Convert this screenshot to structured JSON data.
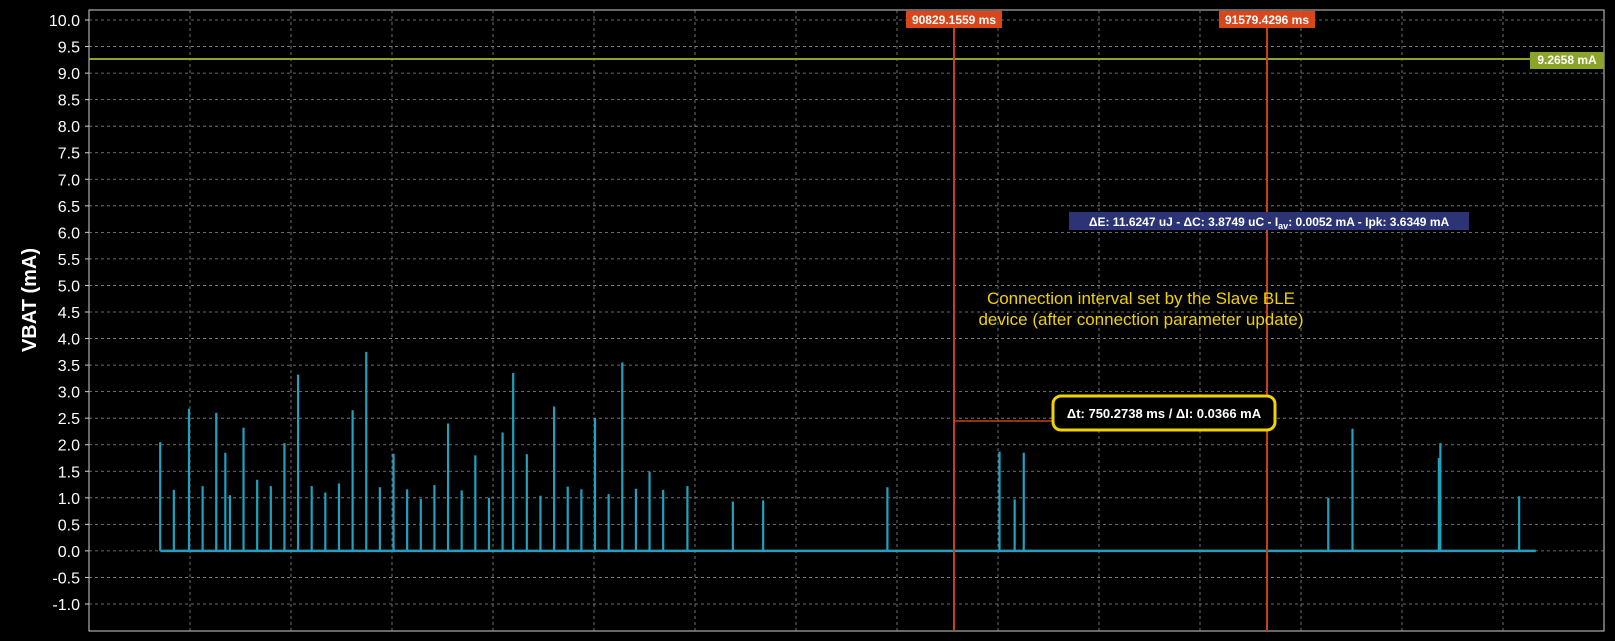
{
  "chart_data": {
    "type": "line",
    "ylabel": "VBAT (mA)",
    "xlabel": "",
    "ylim": [
      -1.0,
      10.0
    ],
    "yticks": [
      "10.0",
      "9.5",
      "9.0",
      "8.5",
      "8.0",
      "7.5",
      "7.0",
      "6.5",
      "6.0",
      "5.5",
      "5.0",
      "4.5",
      "4.0",
      "3.5",
      "3.0",
      "2.5",
      "2.0",
      "1.5",
      "1.0",
      "0.5",
      "0.0",
      "-0.5",
      "-1.0"
    ],
    "grid": true,
    "series": [
      {
        "name": "",
        "color": "#1fa2c0",
        "baseline": 0.0,
        "spikes": [
          {
            "x": 0.047,
            "y": 2.05
          },
          {
            "x": 0.056,
            "y": 1.15
          },
          {
            "x": 0.066,
            "y": 2.68
          },
          {
            "x": 0.075,
            "y": 1.22
          },
          {
            "x": 0.084,
            "y": 2.6
          },
          {
            "x": 0.09,
            "y": 1.85
          },
          {
            "x": 0.093,
            "y": 1.05
          },
          {
            "x": 0.102,
            "y": 2.32
          },
          {
            "x": 0.111,
            "y": 1.34
          },
          {
            "x": 0.12,
            "y": 1.22
          },
          {
            "x": 0.129,
            "y": 2.03
          },
          {
            "x": 0.138,
            "y": 3.32
          },
          {
            "x": 0.147,
            "y": 1.22
          },
          {
            "x": 0.156,
            "y": 1.1
          },
          {
            "x": 0.165,
            "y": 1.27
          },
          {
            "x": 0.174,
            "y": 2.65
          },
          {
            "x": 0.183,
            "y": 3.75
          },
          {
            "x": 0.192,
            "y": 1.2
          },
          {
            "x": 0.201,
            "y": 1.83
          },
          {
            "x": 0.21,
            "y": 1.16
          },
          {
            "x": 0.219,
            "y": 0.98
          },
          {
            "x": 0.228,
            "y": 1.24
          },
          {
            "x": 0.237,
            "y": 2.4
          },
          {
            "x": 0.246,
            "y": 1.14
          },
          {
            "x": 0.255,
            "y": 1.8
          },
          {
            "x": 0.264,
            "y": 1.0
          },
          {
            "x": 0.273,
            "y": 2.23
          },
          {
            "x": 0.28,
            "y": 3.35
          },
          {
            "x": 0.289,
            "y": 1.82
          },
          {
            "x": 0.298,
            "y": 1.04
          },
          {
            "x": 0.307,
            "y": 2.72
          },
          {
            "x": 0.316,
            "y": 1.21
          },
          {
            "x": 0.325,
            "y": 1.16
          },
          {
            "x": 0.334,
            "y": 2.5
          },
          {
            "x": 0.343,
            "y": 1.07
          },
          {
            "x": 0.352,
            "y": 3.55
          },
          {
            "x": 0.361,
            "y": 1.17
          },
          {
            "x": 0.37,
            "y": 1.49
          },
          {
            "x": 0.379,
            "y": 1.15
          },
          {
            "x": 0.395,
            "y": 1.22
          },
          {
            "x": 0.425,
            "y": 0.93
          },
          {
            "x": 0.445,
            "y": 0.95
          },
          {
            "x": 0.527,
            "y": 1.2
          },
          {
            "x": 0.601,
            "y": 1.87
          },
          {
            "x": 0.611,
            "y": 0.97
          },
          {
            "x": 0.617,
            "y": 1.85
          },
          {
            "x": 0.818,
            "y": 1.0
          },
          {
            "x": 0.834,
            "y": 2.3
          },
          {
            "x": 0.891,
            "y": 1.75
          },
          {
            "x": 0.892,
            "y": 2.03
          },
          {
            "x": 0.944,
            "y": 1.03
          }
        ]
      }
    ],
    "markers": {
      "cursor_1_label": "90829.1559 ms",
      "cursor_2_label": "91579.4296 ms",
      "cursor_color": "#c8401a",
      "level_label": "9.2658 mA",
      "level_value": 9.2658,
      "level_color": "#8aa52a"
    },
    "annotations": {
      "stats_parts": [
        "ΔE: 11.6247 uJ - ΔC: 3.8749 uC - I",
        "av",
        ": 0.0052 mA - Ipk: 3.6349 mA"
      ],
      "note_line1": "Connection interval set by the Slave BLE",
      "note_line2": "device (after connection parameter update)",
      "delta": "Δt: 750.2738 ms / ΔI: 0.0366 mA",
      "note_color": "#f0d200",
      "stats_bg": "#2c3476"
    }
  }
}
